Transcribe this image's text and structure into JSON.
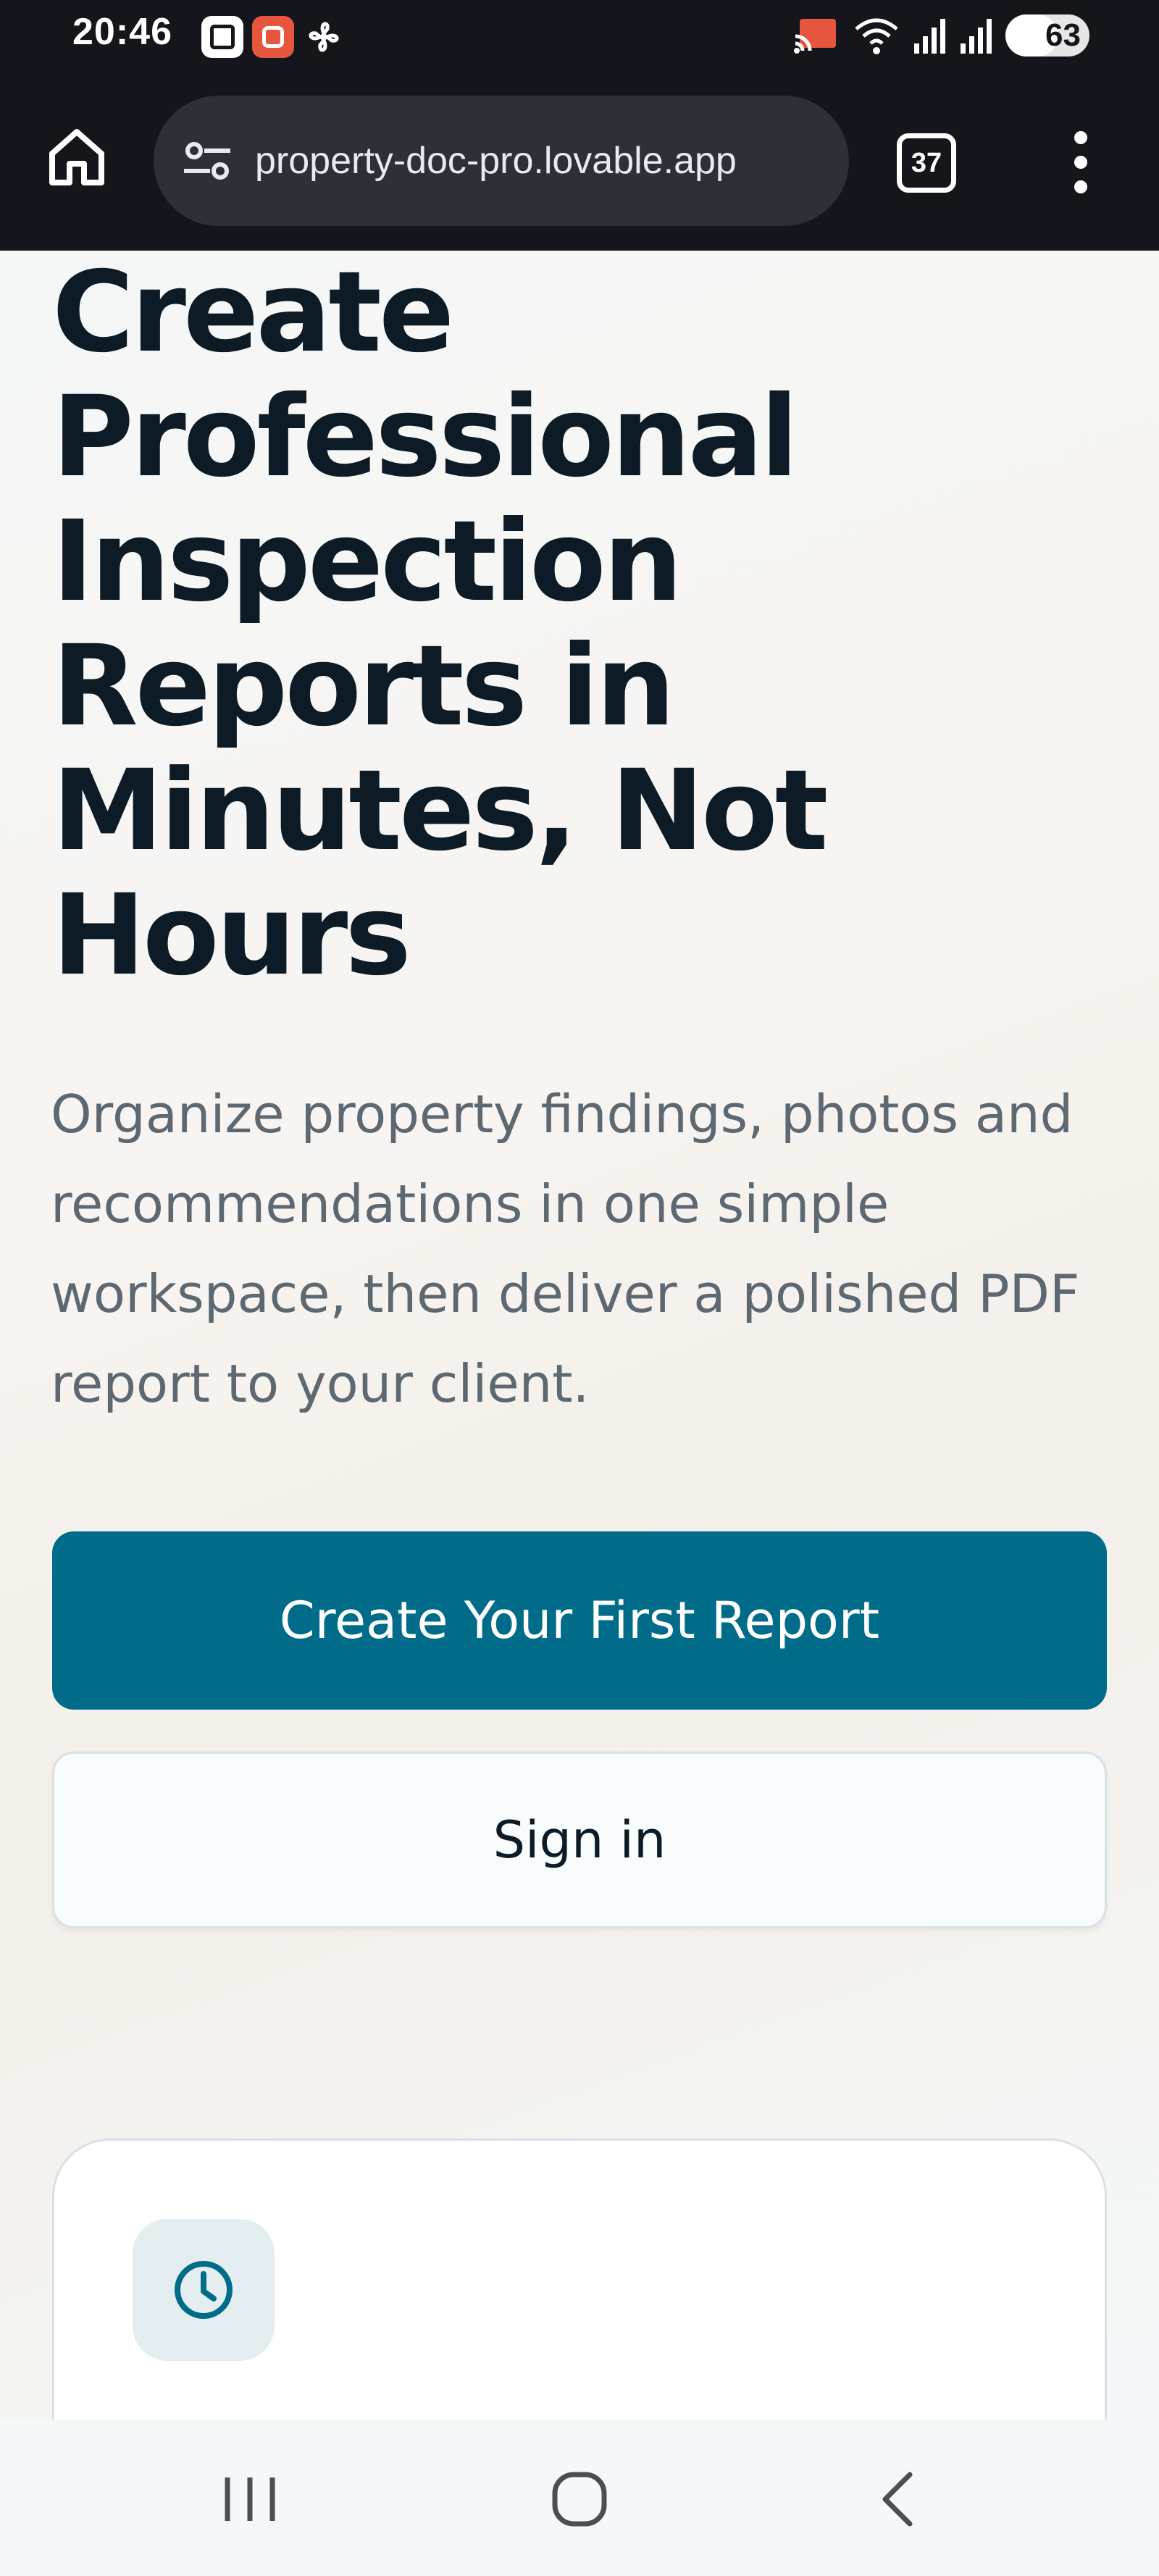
{
  "status_bar": {
    "time": "20:46",
    "battery_percent": "63",
    "icons": [
      "gallery-notification-icon",
      "app-notification-icon",
      "fan-notification-icon",
      "cast-icon",
      "wifi-icon",
      "signal-icon",
      "signal-icon",
      "battery-icon"
    ]
  },
  "browser": {
    "url": "property-doc-pro.lovable.app",
    "tab_count": "37"
  },
  "hero": {
    "title": "Create Professional Inspection Reports in Minutes, Not Hours",
    "subtitle": "Organize property findings, photos and recommendations in one simple workspace, then deliver a polished PDF report to your client."
  },
  "actions": {
    "primary_label": "Create Your First Report",
    "secondary_label": "Sign in"
  },
  "feature_card": {
    "icon": "clock-icon"
  },
  "colors": {
    "accent": "#006c8a",
    "title_text": "#0d1b26",
    "body_text": "#5d6870",
    "chrome_bar": "#14161b"
  }
}
